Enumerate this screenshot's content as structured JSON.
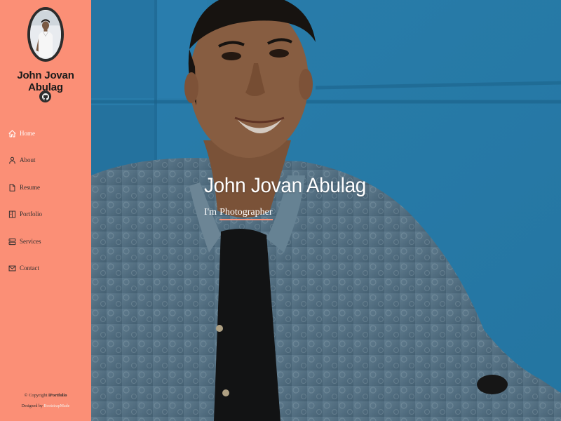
{
  "profile": {
    "name": "John Jovan Abulag"
  },
  "nav": {
    "items": [
      {
        "label": "Home",
        "icon": "home-icon",
        "active": true
      },
      {
        "label": "About",
        "icon": "person-icon",
        "active": false
      },
      {
        "label": "Resume",
        "icon": "file-icon",
        "active": false
      },
      {
        "label": "Portfolio",
        "icon": "book-icon",
        "active": false
      },
      {
        "label": "Services",
        "icon": "server-icon",
        "active": false
      },
      {
        "label": "Contact",
        "icon": "envelope-icon",
        "active": false
      }
    ]
  },
  "footer": {
    "copyright_prefix": "© Copyright",
    "brand": "iPortfolio",
    "designed_by": "Designed by",
    "designer": "BootstrapMade"
  },
  "hero": {
    "title": "John Jovan Abulag",
    "subtitle_prefix": "I'm",
    "subtitle_typed": "Photographer"
  },
  "colors": {
    "sidebar_bg": "#fb8f76",
    "accent": "#fb8f76",
    "hero_bg": "#2e8ec0"
  }
}
